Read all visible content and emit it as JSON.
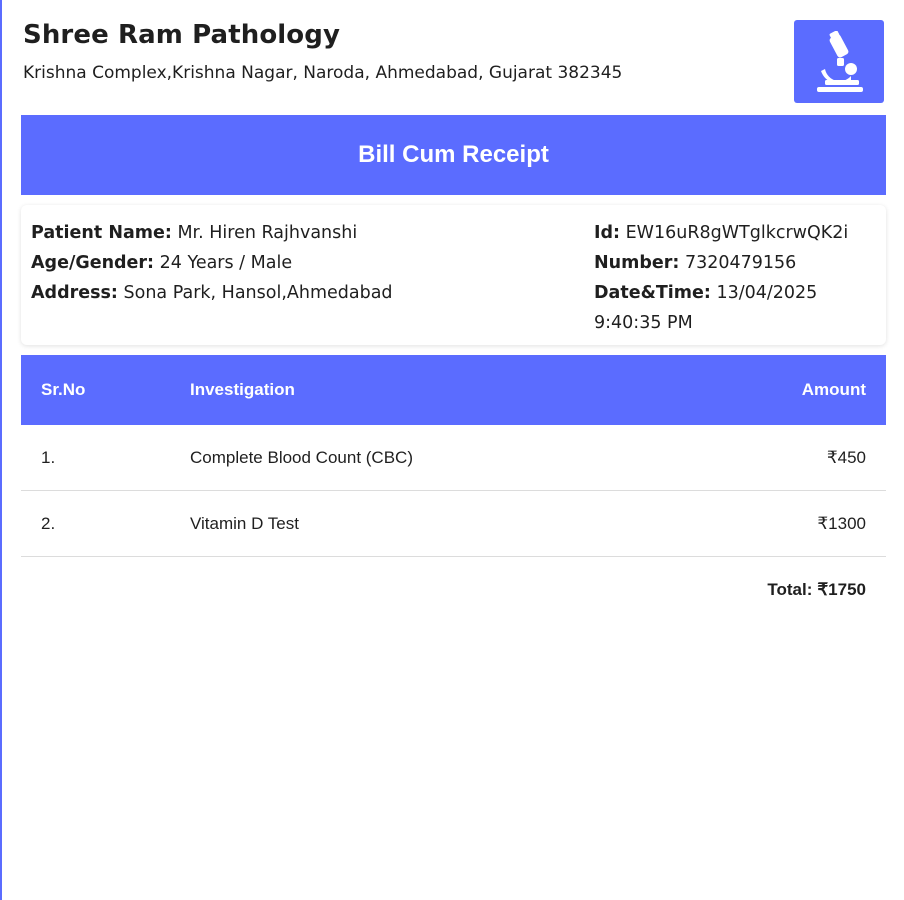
{
  "lab": {
    "name": "Shree Ram Pathology",
    "address": "Krishna Complex,Krishna Nagar, Naroda, Ahmedabad, Gujarat 382345",
    "logo_icon": "microscope-icon",
    "accent_color": "#5b6cff"
  },
  "banner": {
    "title": "Bill Cum Receipt"
  },
  "patient": {
    "name_label": "Patient Name:",
    "name": "Mr. Hiren Rajhvanshi",
    "age_gender_label": "Age/Gender:",
    "age_gender": "24 Years / Male",
    "address_label": "Address:",
    "address": "Sona Park, Hansol,Ahmedabad",
    "id_label": "Id:",
    "id": "EW16uR8gWTglkcrwQK2i",
    "number_label": "Number:",
    "number": "7320479156",
    "datetime_label": "Date&Time:",
    "datetime": "13/04/2025 9:40:35 PM"
  },
  "table": {
    "headers": [
      "Sr.No",
      "Investigation",
      "Amount"
    ],
    "rows": [
      {
        "sr": "1.",
        "investigation": "Complete Blood Count (CBC)",
        "amount": "₹450"
      },
      {
        "sr": "2.",
        "investigation": "Vitamin D Test",
        "amount": "₹1300"
      }
    ],
    "total_label": "Total:",
    "total_value": "₹1750"
  }
}
